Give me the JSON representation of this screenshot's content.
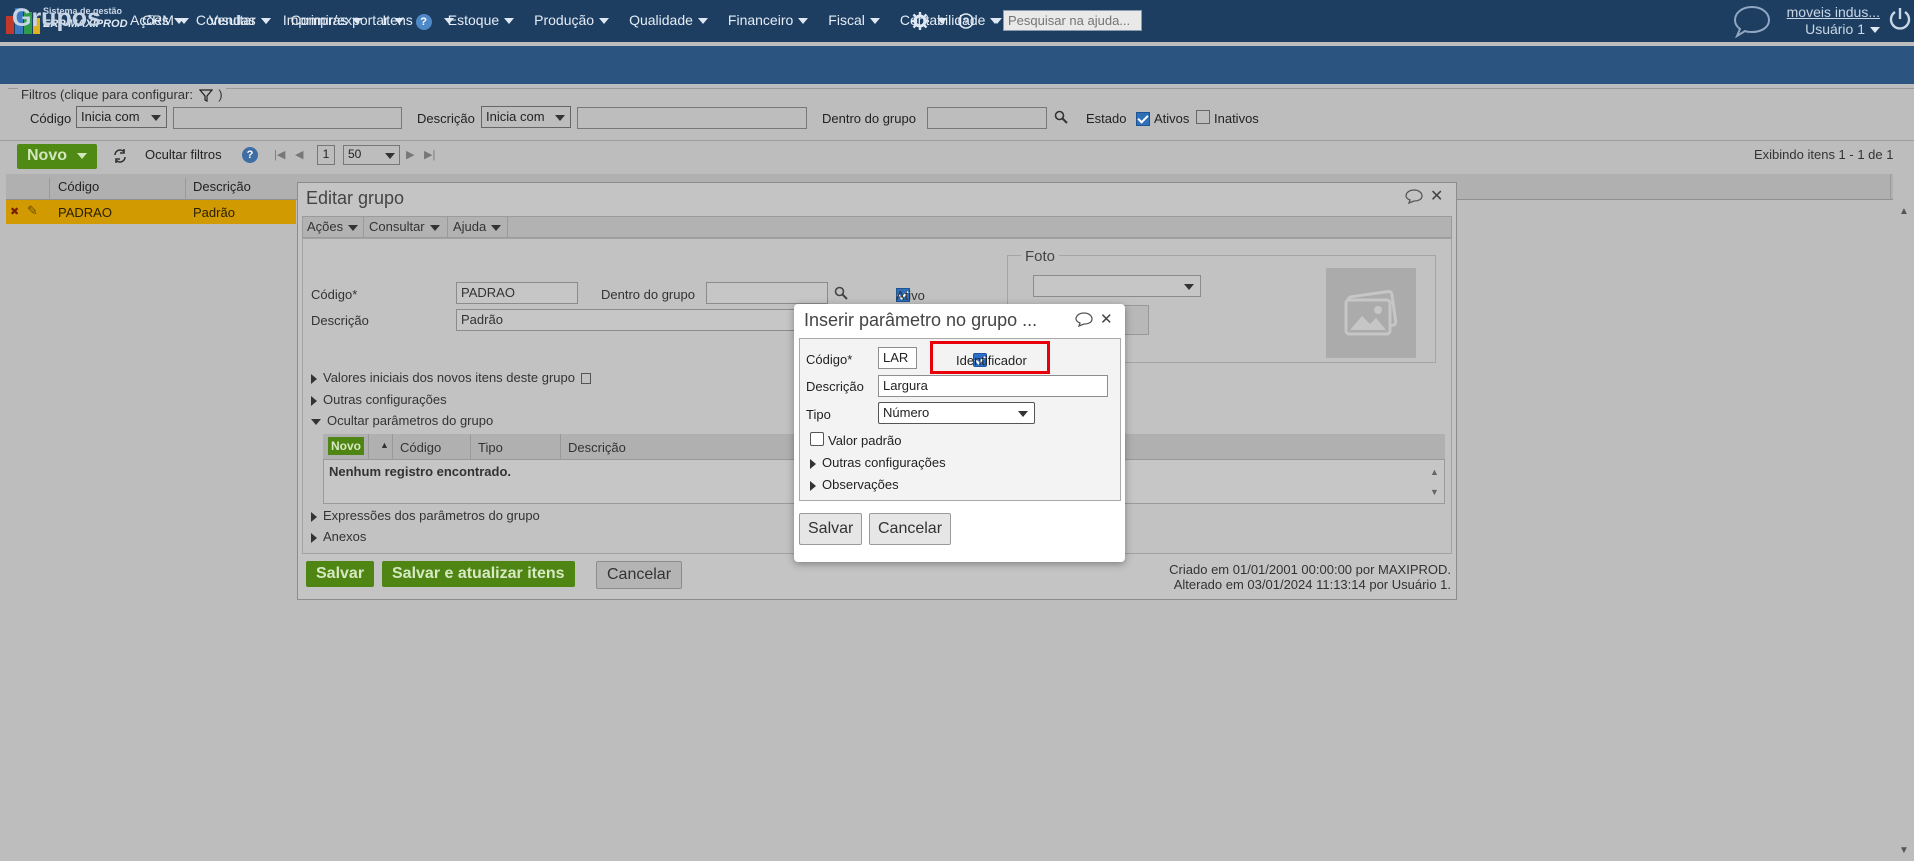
{
  "app": {
    "brand_line1": "Sistema de gestão",
    "brand_line2": "ERP MAXIPROD",
    "menu": [
      "CRM",
      "Vendas",
      "Compras",
      "Itens",
      "Estoque",
      "Produção",
      "Qualidade",
      "Financeiro",
      "Fiscal",
      "Contabilidade"
    ],
    "help_placeholder": "Pesquisar na ajuda...",
    "company": "moveis indus...",
    "user": "Usuário 1"
  },
  "page": {
    "title": "Grupos",
    "menu": [
      "Ações",
      "Consultar",
      "Imprimir/exportar"
    ]
  },
  "filters": {
    "legend": "Filtros (clique para configurar:",
    "legend_close": ")",
    "codigo_label": "Código",
    "codigo_mode": "Inicia com",
    "descricao_label": "Descrição",
    "descricao_mode": "Inicia com",
    "dentro_label": "Dentro do grupo",
    "estado_label": "Estado",
    "ativos_label": "Ativos",
    "inativos_label": "Inativos"
  },
  "toolbar": {
    "novo": "Novo",
    "ocultar_filtros": "Ocultar filtros",
    "page": "1",
    "page_size": "50",
    "status": "Exibindo itens 1 - 1 de 1"
  },
  "grid": {
    "col_codigo": "Código",
    "col_descricao": "Descrição",
    "row_codigo": "PADRAO",
    "row_descricao": "Padrão"
  },
  "edit_dialog": {
    "title": "Editar grupo",
    "menu": [
      "Ações",
      "Consultar",
      "Ajuda"
    ],
    "codigo_label": "Código*",
    "codigo_value": "PADRAO",
    "dentro_label": "Dentro do grupo",
    "ativo_label": "Ativo",
    "descricao_label": "Descrição",
    "descricao_value": "Padrão",
    "foto_label": "Foto",
    "sec_valores": "Valores iniciais dos novos itens deste grupo",
    "sec_outras": "Outras configurações",
    "sec_ocultar": "Ocultar parâmetros do grupo",
    "sub_novo": "Novo",
    "sub_col_codigo": "Código",
    "sub_col_tipo": "Tipo",
    "sub_col_descricao": "Descrição",
    "sub_empty": "Nenhum registro encontrado.",
    "sec_expressoes": "Expressões dos parâmetros do grupo",
    "sec_anexos": "Anexos",
    "btn_salvar": "Salvar",
    "btn_salvar_atualizar": "Salvar e atualizar itens",
    "btn_cancelar": "Cancelar",
    "criado": "Criado em 01/01/2001 00:00:00 por MAXIPROD.",
    "alterado": "Alterado em 03/01/2024 11:13:14 por Usuário 1."
  },
  "modal": {
    "title": "Inserir parâmetro no grupo ...",
    "codigo_label": "Código*",
    "codigo_value": "LAR",
    "identificador_label": "Identificador",
    "descricao_label": "Descrição",
    "descricao_value": "Largura",
    "tipo_label": "Tipo",
    "tipo_value": "Número",
    "valor_padrao_label": "Valor padrão",
    "outras_label": "Outras configurações",
    "observacoes_label": "Observações",
    "btn_salvar": "Salvar",
    "btn_cancelar": "Cancelar"
  },
  "colors": {
    "topbar": "#1d3e61",
    "pagehead": "#2b5480",
    "green": "#4f8a14",
    "highlight": "#e8000b",
    "row_selected": "#d19a00"
  }
}
